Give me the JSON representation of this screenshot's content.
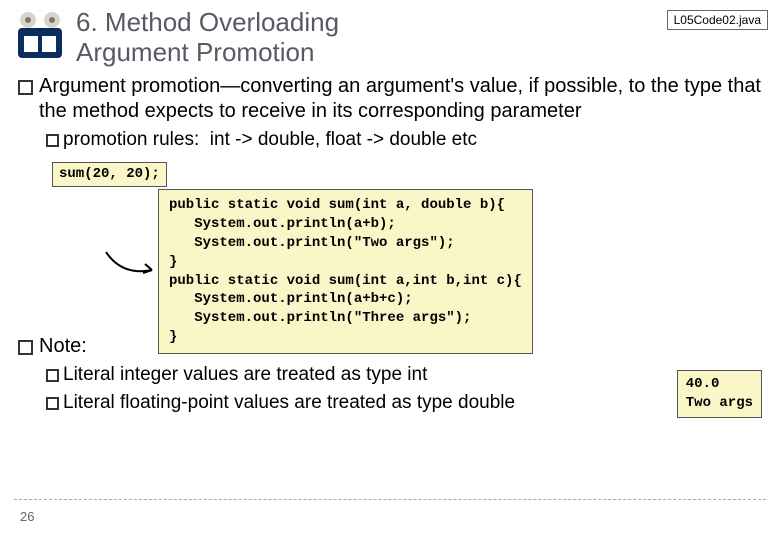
{
  "file_badge": "L05Code02.java",
  "title": {
    "line1": "6. Method Overloading",
    "line2": "Argument Promotion"
  },
  "main_bullet": "Argument promotion—converting an argument's value, if possible, to the type that the method expects to receive in its corresponding parameter",
  "sub_bullet_label": "promotion rules:",
  "sub_bullet_rest": "  int -> double, float -> double etc",
  "code_call": "sum(20, 20);",
  "code_block": "public static void sum(int a, double b){\n   System.out.println(a+b);\n   System.out.println(\"Two args\");\n}\npublic static void sum(int a,int b,int c){\n   System.out.println(a+b+c);\n   System.out.println(\"Three args\");\n}",
  "output": "40.0\nTwo args",
  "note_label": "Note:",
  "note1": "Literal integer values are treated as type int",
  "note2": "Literal floating-point values are treated as type double",
  "page_number": "26"
}
